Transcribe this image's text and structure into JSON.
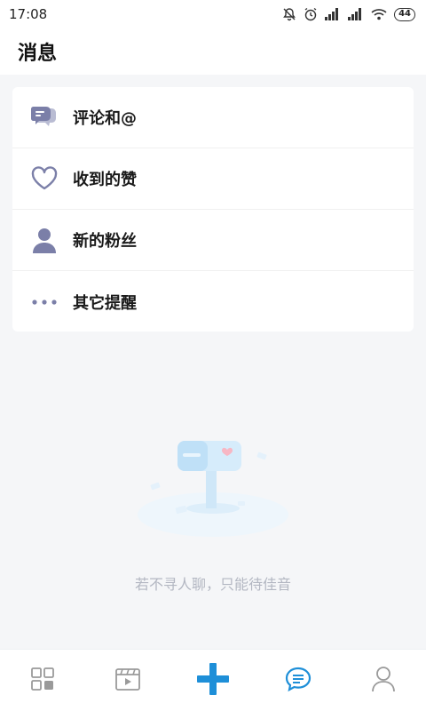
{
  "status_bar": {
    "time": "17:08",
    "battery": "44",
    "icons": [
      "mute-bell-icon",
      "alarm-icon",
      "signal-icon",
      "signal-icon",
      "wifi-icon",
      "battery-icon"
    ]
  },
  "header": {
    "title": "消息"
  },
  "menu": {
    "items": [
      {
        "label": "评论和@",
        "icon": "comment-icon"
      },
      {
        "label": "收到的赞",
        "icon": "heart-icon"
      },
      {
        "label": "新的粉丝",
        "icon": "person-icon"
      },
      {
        "label": "其它提醒",
        "icon": "more-dots-icon"
      }
    ]
  },
  "empty_state": {
    "text": "若不寻人聊，只能待佳音",
    "illustration": "mailbox-illustration"
  },
  "tab_bar": {
    "tabs": [
      {
        "icon": "grid-icon",
        "active": false
      },
      {
        "icon": "video-icon",
        "active": false
      },
      {
        "icon": "plus-icon",
        "active": false
      },
      {
        "icon": "message-icon",
        "active": true
      },
      {
        "icon": "profile-icon",
        "active": false
      }
    ]
  },
  "colors": {
    "accent": "#1e8fd8",
    "icon_purple": "#7b7fa8",
    "background": "#f5f6f8",
    "empty_text": "#b3b7c2"
  }
}
